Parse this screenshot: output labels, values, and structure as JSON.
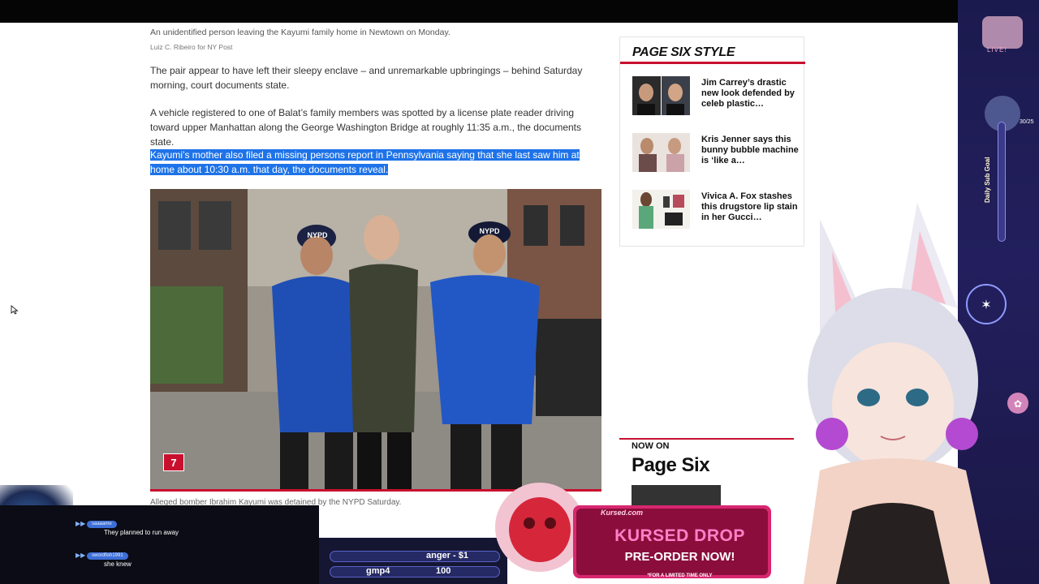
{
  "article": {
    "caption": "An unidentified person leaving the Kayumi family home in Newtown on Monday.",
    "credit": "Luiz C. Ribeiro for NY Post",
    "paragraphs": [
      "The pair appear to have left their sleepy enclave – and unremarkable upbringings – behind Saturday morning, court documents state.",
      "A vehicle registered to one of Balat’s family members was spotted by a license plate reader driving toward upper Manhattan along the George Washington Bridge at roughly 11:35 a.m., the documents state."
    ],
    "highlighted_paragraph": "Kayumi’s mother also filed a missing persons report in Pennsylvania saying that she last saw him at home about 10:30 a.m. that day, the documents reveal.",
    "photo_badge": "7",
    "photo_caption": "Alleged bomber Ibrahim Kayumi was detained by the NYPD Saturday.",
    "officer_cap_text": "NYPD"
  },
  "page_six_style": {
    "title": "PAGE SIX STYLE",
    "stories": [
      {
        "headline": "Jim Carrey’s drastic new look defended by celeb plastic…"
      },
      {
        "headline": "Kris Jenner says this bunny bubble machine is ‘like a…"
      },
      {
        "headline": "Vivica A. Fox stashes this drugstore lip stain in her Gucci…"
      }
    ]
  },
  "now_on": {
    "label": "NOW ON",
    "brand": "Page Six"
  },
  "overlay": {
    "live_label": "LIVE!",
    "goal_count": "30/25",
    "goal_label": "Daily Sub Goal",
    "chat": [
      {
        "name": "saaaame",
        "text": "They planned to run away"
      },
      {
        "name": "swordfish1991",
        "text": "she knew"
      }
    ],
    "redeems": [
      {
        "text": "anger - $1"
      },
      {
        "text": "gmp4",
        "value": "100"
      }
    ],
    "promo": {
      "site": "Kursed.com",
      "title": "KURSED DROP",
      "cta": "PRE-ORDER NOW!",
      "note": "*FOR A LIMITED TIME ONLY"
    }
  },
  "colors": {
    "brand_red": "#c8102e",
    "highlight": "#1e73e8",
    "overlay_purple": "#1b1a4e"
  }
}
